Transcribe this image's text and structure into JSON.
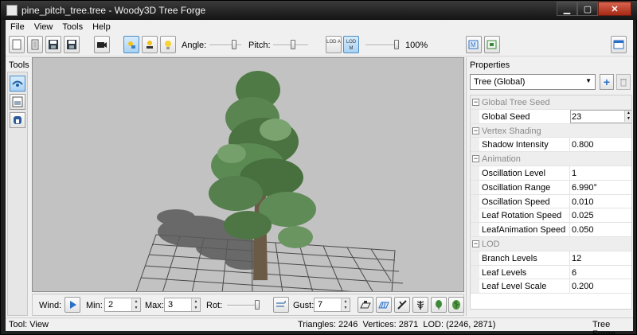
{
  "window": {
    "title": "pine_pitch_tree.tree - Woody3D Tree Forge"
  },
  "menu": [
    "File",
    "View",
    "Tools",
    "Help"
  ],
  "toolbar": {
    "angle_label": "Angle:",
    "pitch_label": "Pitch:",
    "lod_a_label": "LOD A",
    "lod_m_label": "LOD M",
    "lod_percent": "100%"
  },
  "tools_panel": {
    "title": "Tools"
  },
  "wind_bar": {
    "wind_label": "Wind:",
    "min_label": "Min:",
    "min_value": "2",
    "max_label": "Max:",
    "max_value": "3",
    "rot_label": "Rot:",
    "gust_label": "Gust:",
    "gust_value": "7"
  },
  "properties": {
    "title": "Properties",
    "selected_object": "Tree (Global)",
    "rows": [
      {
        "type": "category",
        "name": "Global Tree Seed"
      },
      {
        "type": "prop",
        "name": "Global Seed",
        "value": "23",
        "editing": true
      },
      {
        "type": "category",
        "name": "Vertex Shading"
      },
      {
        "type": "prop",
        "name": "Shadow Intensity",
        "value": "0.800"
      },
      {
        "type": "category",
        "name": "Animation"
      },
      {
        "type": "prop",
        "name": "Oscillation Level",
        "value": "1"
      },
      {
        "type": "prop",
        "name": "Oscillation Range",
        "value": "6.990°"
      },
      {
        "type": "prop",
        "name": "Oscillation Speed",
        "value": "0.010"
      },
      {
        "type": "prop",
        "name": "Leaf Rotation Speed",
        "value": "0.025"
      },
      {
        "type": "prop",
        "name": "LeafAnimation Speed",
        "value": "0.050"
      },
      {
        "type": "category",
        "name": "LOD"
      },
      {
        "type": "prop",
        "name": "Branch Levels",
        "value": "12"
      },
      {
        "type": "prop",
        "name": "Leaf Levels",
        "value": "6"
      },
      {
        "type": "prop",
        "name": "Leaf Level Scale",
        "value": "0.200"
      }
    ]
  },
  "status_bar": {
    "tool": "Tool: View",
    "stats": "Triangles: 2246  Vertices: 2871  LOD: (2246, 2871)",
    "app": "Tree Forge"
  },
  "colors": {
    "accent": "#4a8cc4",
    "viewport_bg": "#c2c2c2",
    "foliage": "#4f7a45",
    "trunk": "#6b5a45"
  }
}
